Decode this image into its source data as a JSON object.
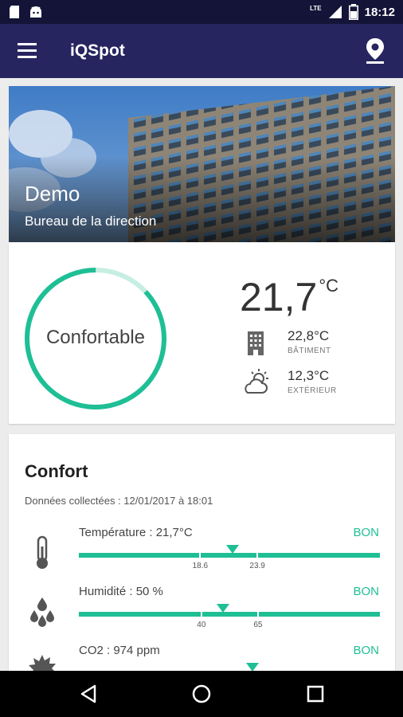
{
  "status_bar": {
    "time": "18:12",
    "network": "LTE",
    "colors": {
      "background": "#141438"
    }
  },
  "app_bar": {
    "title": "iQSpot",
    "colors": {
      "background": "#262560"
    }
  },
  "hero": {
    "site_name": "Demo",
    "room_name": "Bureau de la direction"
  },
  "summary": {
    "comfort_label": "Confortable",
    "comfort_level": 0.87,
    "indoor_temp": "21,7",
    "indoor_unit": "°C",
    "building_temp": "22,8°C",
    "building_label": "BÂTIMENT",
    "outdoor_temp": "12,3°C",
    "outdoor_label": "EXTÉRIEUR"
  },
  "confort": {
    "title": "Confort",
    "collected": "Données collectées : 12/01/2017 à 18:01",
    "metrics": [
      {
        "icon": "thermometer-icon",
        "label": "Température : 21,7°C",
        "status": "BON",
        "ticks": [
          "18.6",
          "23.9"
        ],
        "tick_positions": [
          0.403,
          0.593
        ],
        "marker_position": 0.511
      },
      {
        "icon": "water-drops-icon",
        "label": "Humidité : 50 %",
        "status": "BON",
        "ticks": [
          "40",
          "65"
        ],
        "tick_positions": [
          0.407,
          0.595
        ],
        "marker_position": 0.479
      },
      {
        "icon": "co2-icon",
        "label": "CO2 : 974 ppm",
        "status": "BON",
        "ticks": [],
        "tick_positions": [],
        "marker_position": 0.577
      }
    ],
    "colors": {
      "accent": "#1fbf95"
    }
  },
  "nav": {
    "back": "back-icon",
    "home": "home-icon",
    "recents": "recents-icon"
  }
}
